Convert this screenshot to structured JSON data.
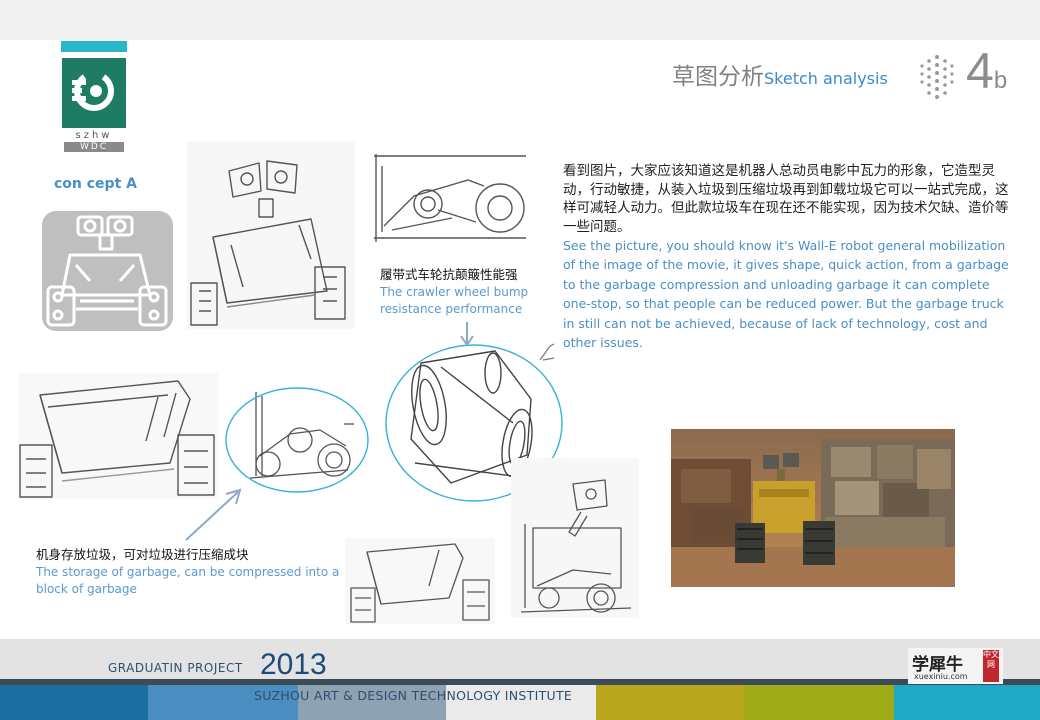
{
  "header": {
    "title_cn": "草图分析",
    "title_en": "Sketch analysis",
    "slide_number": "4",
    "slide_letter": "b"
  },
  "logo": {
    "text_line1": "szhw",
    "text_line2": "WDC"
  },
  "concept_label": "con  cept A",
  "description": {
    "cn": "看到图片，大家应该知道这是机器人总动员电影中瓦力的形象，它造型灵动，行动敏捷，从装入垃圾到压缩垃圾再到卸载垃圾它可以一站式完成，这样可减轻人动力。但此款垃圾车在现在还不能实现，因为技术欠缺、造价等一些问题。",
    "en": "See the picture, you should know it's Wall-E robot general mobilization of the image of the movie, it gives shape, quick action, from a garbage to the garbage compression and unloading garbage it can complete one-stop, so that people can be reduced power. But the garbage truck in still can not be achieved, because of lack of technology, cost and other issues."
  },
  "annotations": {
    "crawler_cn": "履带式车轮抗颠簸性能强",
    "crawler_en": "The crawler wheel bump resistance performance",
    "storage_cn": "机身存放垃圾，可对垃圾进行压缩成块",
    "storage_en": "The storage of garbage, can be compressed into a block of garbage"
  },
  "footer": {
    "project_label": "GRADUATIN  PROJECT",
    "year": "2013",
    "institute": "SUZHOU ART & DESIGN TECHNOLOGY INSTITUTE",
    "stamp_cn": "学犀牛",
    "stamp_url": "xuexiniu.com",
    "stamp_badge": "中文网"
  },
  "colors": {
    "accent_blue": "#4a8fc4",
    "title_gray": "#808080",
    "logo_green": "#1d7c63",
    "strip_cyan": "#2bb6c8",
    "circle_cyan": "#36b2d9",
    "footer_strip": [
      "#1a6fa0",
      "#3b82b8",
      "#8fa3b0",
      "#e8e8e8",
      "#b7a61f",
      "#9aa81a",
      "#1aa9c4"
    ]
  }
}
